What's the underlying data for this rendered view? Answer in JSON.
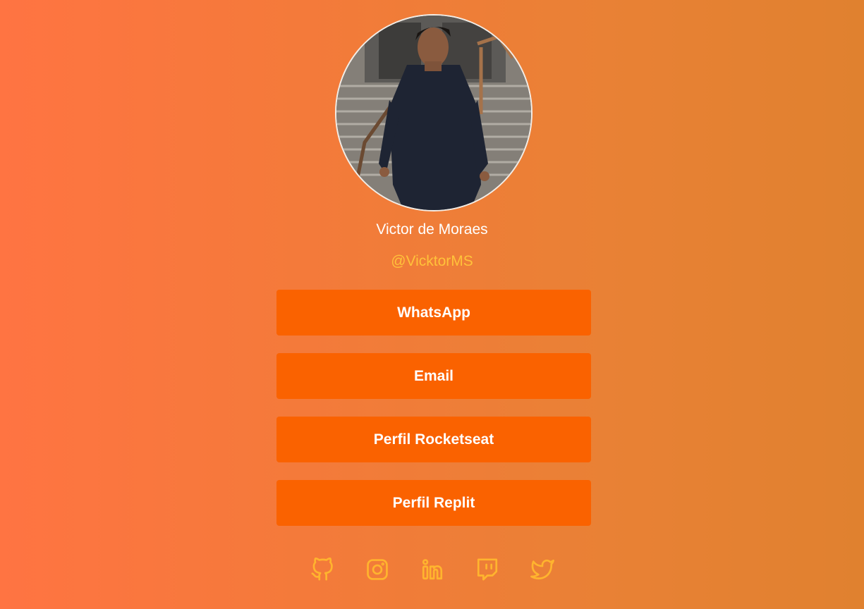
{
  "profile": {
    "name": "Victor de Moraes",
    "handle": "@VicktorMS"
  },
  "links": [
    {
      "label": "WhatsApp"
    },
    {
      "label": "Email"
    },
    {
      "label": "Perfil Rocketseat"
    },
    {
      "label": "Perfil Replit"
    }
  ],
  "socials": [
    {
      "icon": "github-icon"
    },
    {
      "icon": "instagram-icon"
    },
    {
      "icon": "linkedin-icon"
    },
    {
      "icon": "twitch-icon"
    },
    {
      "icon": "twitter-icon"
    }
  ],
  "colors": {
    "background_start": "#ff7442",
    "background_end": "#e0812f",
    "button": "#fa6200",
    "handle": "#ffc23a",
    "icon": "#ffb42e"
  }
}
